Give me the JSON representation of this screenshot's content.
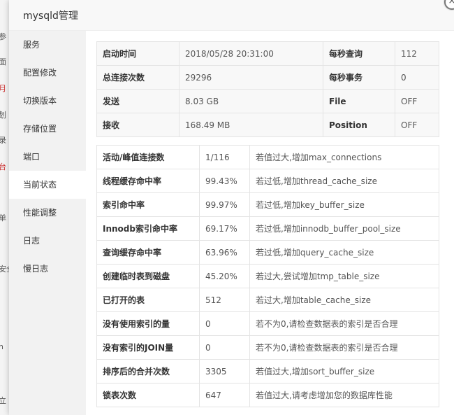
{
  "background_fragments": [
    "参",
    "面",
    "月",
    "划",
    "录",
    "台",
    "单",
    "安全",
    "n",
    "立"
  ],
  "dialog": {
    "title": "mysqld管理",
    "close_icon": "×"
  },
  "sidebar": {
    "items": [
      {
        "label": "服务"
      },
      {
        "label": "配置修改"
      },
      {
        "label": "切换版本"
      },
      {
        "label": "存储位置"
      },
      {
        "label": "端口"
      },
      {
        "label": "当前状态"
      },
      {
        "label": "性能调整"
      },
      {
        "label": "日志"
      },
      {
        "label": "慢日志"
      }
    ],
    "active_index": 5
  },
  "summary": {
    "rows": [
      {
        "k1": "启动时间",
        "v1": "2018/05/28 20:31:00",
        "k2": "每秒查询",
        "v2": "112"
      },
      {
        "k1": "总连接次数",
        "v1": "29296",
        "k2": "每秒事务",
        "v2": "0"
      },
      {
        "k1": "发送",
        "v1": "8.03 GB",
        "k2": "File",
        "v2": "OFF"
      },
      {
        "k1": "接收",
        "v1": "168.49 MB",
        "k2": "Position",
        "v2": "OFF"
      }
    ]
  },
  "metrics": {
    "rows": [
      {
        "name": "活动/峰值连接数",
        "value": "1/116",
        "hint": "若值过大,增加max_connections"
      },
      {
        "name": "线程缓存命中率",
        "value": "99.43%",
        "hint": "若过低,增加thread_cache_size"
      },
      {
        "name": "索引命中率",
        "value": "99.97%",
        "hint": "若过低,增加key_buffer_size"
      },
      {
        "name": "Innodb索引命中率",
        "value": "69.17%",
        "hint": "若过低,增加innodb_buffer_pool_size"
      },
      {
        "name": "查询缓存命中率",
        "value": "63.96%",
        "hint": "若过低,增加query_cache_size"
      },
      {
        "name": "创建临时表到磁盘",
        "value": "45.20%",
        "hint": "若过大,尝试增加tmp_table_size"
      },
      {
        "name": "已打开的表",
        "value": "512",
        "hint": "若过大,增加table_cache_size"
      },
      {
        "name": "没有使用索引的量",
        "value": "0",
        "hint": "若不为0,请检查数据表的索引是否合理"
      },
      {
        "name": "没有索引的JOIN量",
        "value": "0",
        "hint": "若不为0,请检查数据表的索引是否合理"
      },
      {
        "name": "排序后的合并次数",
        "value": "3305",
        "hint": "若值过大,增加sort_buffer_size"
      },
      {
        "name": "锁表次数",
        "value": "647",
        "hint": "若值过大,请考虑增加您的数据库性能"
      }
    ]
  }
}
